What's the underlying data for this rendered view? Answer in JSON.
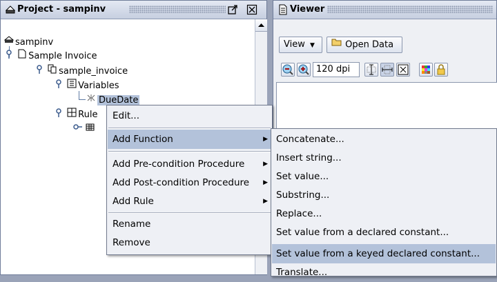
{
  "project_panel": {
    "title": "Project - sampinv",
    "tree": {
      "root": "sampinv",
      "invoice": "Sample Invoice",
      "sample_invoice": "sample_invoice",
      "variables": "Variables",
      "due_date": "DueDate",
      "rules": "Rule"
    }
  },
  "viewer_panel": {
    "title": "Viewer",
    "view_button": "View",
    "open_data_button": "Open Data",
    "dpi": "120 dpi"
  },
  "context_menu": {
    "items": [
      {
        "label": "Edit..."
      },
      {
        "label": "Add Function"
      },
      {
        "label": "Add Pre-condition Procedure"
      },
      {
        "label": "Add Post-condition Procedure"
      },
      {
        "label": "Add Rule"
      },
      {
        "label": "Rename"
      },
      {
        "label": "Remove"
      }
    ]
  },
  "function_submenu": {
    "items": [
      {
        "label": "Concatenate..."
      },
      {
        "label": "Insert string..."
      },
      {
        "label": "Set value..."
      },
      {
        "label": "Substring..."
      },
      {
        "label": "Replace..."
      },
      {
        "label": "Set value from a declared constant..."
      },
      {
        "label": "Set value from a keyed declared constant..."
      },
      {
        "label": "Translate..."
      }
    ]
  },
  "colors": {
    "selection": "#b3c2da",
    "menu_bg": "#eef0f5",
    "title_gradient_top": "#e4e9f3",
    "title_gradient_bottom": "#c6cfe0"
  }
}
